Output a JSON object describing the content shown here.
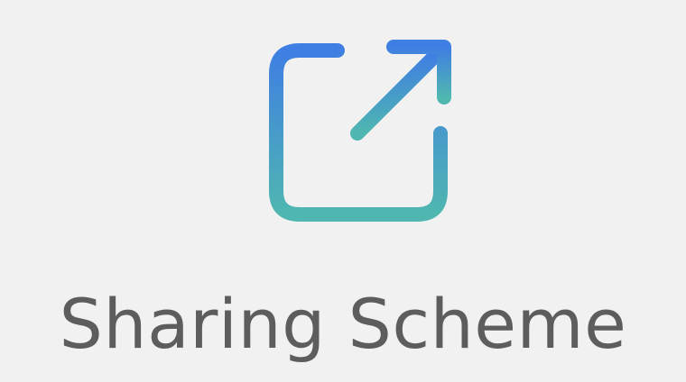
{
  "tile": {
    "icon": "share-external-icon",
    "label": "Sharing Scheme"
  },
  "colors": {
    "background": "#f1f1f1",
    "icon_gradient_top": "#3f7ee3",
    "icon_gradient_bottom": "#4fb7b0",
    "label": "#5d5d5d"
  }
}
